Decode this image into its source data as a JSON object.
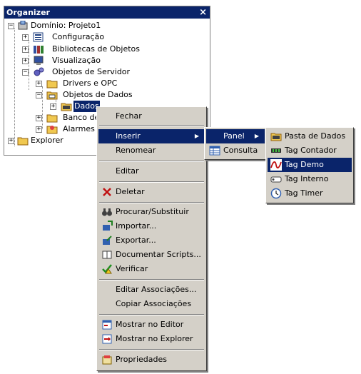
{
  "organizer": {
    "title": "Organizer",
    "close_glyph": "×",
    "tree": {
      "root": "Domínio: Projeto1",
      "configuracao": "Configuração",
      "bibliotecas": "Bibliotecas de Objetos",
      "visualizacao": "Visualização",
      "objetos_servidor": "Objetos de Servidor",
      "drivers": "Drivers e OPC",
      "objetos_dados": "Objetos de Dados",
      "dados": "Dados",
      "banco": "Banco de",
      "alarmes": "Alarmes",
      "explorer": "Explorer"
    }
  },
  "context_menu": {
    "fechar": "Fechar",
    "inserir": "Inserir",
    "renomear": "Renomear",
    "editar": "Editar",
    "deletar": "Deletar",
    "procurar": "Procurar/Substituir",
    "importar": "Importar...",
    "exportar": "Exportar...",
    "documentar": "Documentar Scripts...",
    "verificar": "Verificar",
    "editar_assoc": "Editar Associações...",
    "copiar_assoc": "Copiar Associações",
    "mostrar_editor": "Mostrar no Editor",
    "mostrar_explorer": "Mostrar no Explorer",
    "propriedades": "Propriedades"
  },
  "insert_submenu": {
    "panel": "Panel",
    "consulta": "Consulta"
  },
  "panel_submenu": {
    "pasta": "Pasta de Dados",
    "contador": "Tag Contador",
    "demo": "Tag Demo",
    "interno": "Tag Interno",
    "timer": "Tag Timer"
  },
  "colors": {
    "highlight": "#0a246a",
    "menu_bg": "#d4d0c8"
  }
}
